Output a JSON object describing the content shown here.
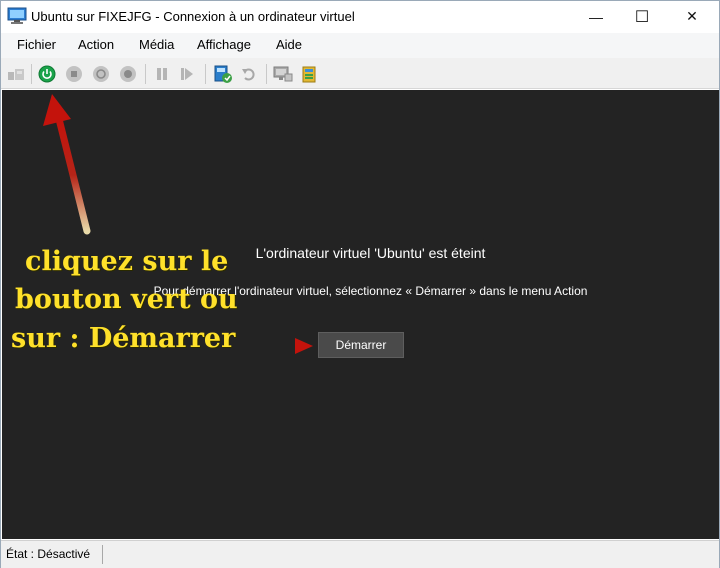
{
  "window": {
    "title": "Ubuntu sur FIXEJFG - Connexion à un ordinateur virtuel",
    "controls": {
      "minimize": "—",
      "maximize": "☐",
      "close": "✕"
    }
  },
  "menu": {
    "items": [
      "Fichier",
      "Action",
      "Média",
      "Affichage",
      "Aide"
    ]
  },
  "toolbar": {
    "buttons": [
      "ctrl-alt-del-icon",
      "start-icon",
      "turn-off-icon",
      "shutdown-icon",
      "save-icon",
      "pause-icon",
      "reset-icon",
      "checkpoint-icon",
      "revert-icon",
      "enhanced-session-icon",
      "share-icon"
    ],
    "accent_color": "#1aa34a"
  },
  "console": {
    "title": "L'ordinateur virtuel 'Ubuntu' est éteint",
    "message": "Pour démarrer l'ordinateur virtuel, sélectionnez « Démarrer » dans le menu Action",
    "start_button": "Démarrer",
    "background_color": "#232323"
  },
  "annotation": {
    "lines": [
      "cliquez sur le",
      "bouton vert ou",
      "sur :  Démarrer"
    ],
    "text_color": "#ffe12a",
    "arrow_color": "#c4130c"
  },
  "status": {
    "text": "État : Désactivé"
  }
}
